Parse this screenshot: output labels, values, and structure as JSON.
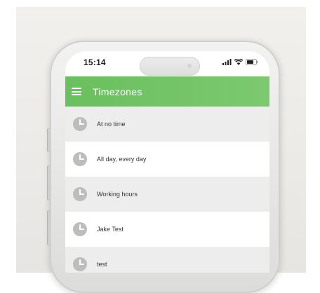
{
  "status_bar": {
    "time": "15:14",
    "icons": [
      "signal-icon",
      "wifi-icon",
      "battery-icon"
    ]
  },
  "app_bar": {
    "title": "Timezones",
    "menu_icon": "hamburger-menu-icon",
    "color": "#6dbf5f"
  },
  "timezones": [
    {
      "label": "At no time",
      "icon": "clock-icon"
    },
    {
      "label": "All day, every day",
      "icon": "clock-icon"
    },
    {
      "label": "Working hours",
      "icon": "clock-icon"
    },
    {
      "label": "Jake Test",
      "icon": "clock-icon"
    },
    {
      "label": "test",
      "icon": "clock-icon"
    }
  ]
}
